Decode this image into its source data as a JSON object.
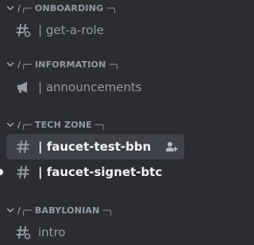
{
  "categories": [
    {
      "label": "/╭─ ONBOARDING ─╮",
      "channel": {
        "name": "| get-a-role",
        "icon": "hash-with-thread-icon"
      }
    },
    {
      "label": "/╭─ INFORMATION ─╮",
      "channel": {
        "name": "| announcements",
        "icon": "megaphone-icon"
      }
    },
    {
      "label": "/╭─ TECH ZONE ─╮",
      "channels": [
        {
          "name": "| faucet-test-bbn",
          "icon": "hash-icon",
          "state": "selected",
          "action_icon": "add-member-icon"
        },
        {
          "name": "| faucet-signet-btc",
          "icon": "hash-icon",
          "state": "unread"
        }
      ]
    },
    {
      "label": "/╭─ BABYLONIAN ─╮",
      "channel": {
        "name": "intro",
        "icon": "hash-with-thread-icon"
      }
    }
  ],
  "colors": {
    "background": "#2b2d31",
    "muted_text": "#949ba4",
    "bright_text": "#f2f3f5",
    "selected_bg": "#404249"
  }
}
